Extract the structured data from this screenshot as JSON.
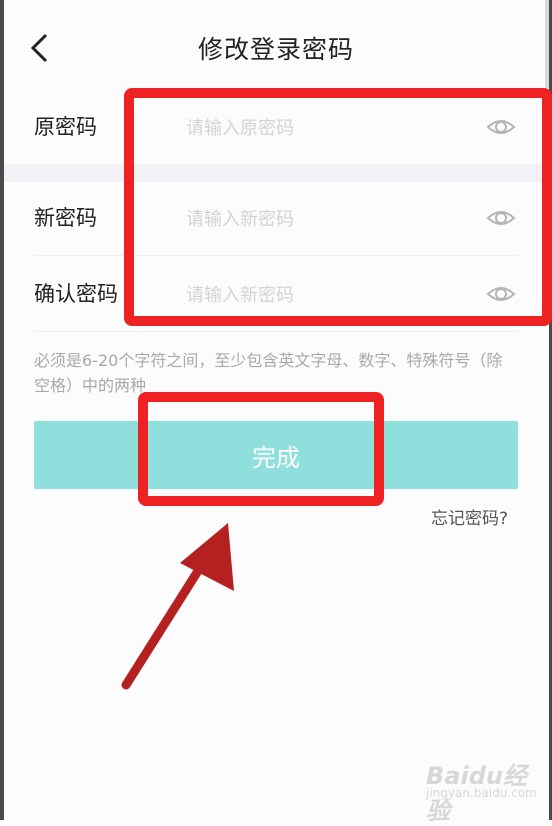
{
  "header": {
    "title": "修改登录密码",
    "back_icon": "chevron-left-icon"
  },
  "form": {
    "fields": [
      {
        "label": "原密码",
        "placeholder": "请输入原密码",
        "icon": "eye-icon"
      },
      {
        "label": "新密码",
        "placeholder": "请输入新密码",
        "icon": "eye-icon"
      },
      {
        "label": "确认密码",
        "placeholder": "请输入新密码",
        "icon": "eye-icon"
      }
    ],
    "hint": "必须是6-20个字符之间，至少包含英文字母、数字、特殊符号（除空格）中的两种",
    "submit_label": "完成",
    "forgot_label": "忘记密码?"
  },
  "annotation": {
    "color": "#ee2222",
    "arrow_color": "#b52020"
  },
  "theme": {
    "button_bg": "#8fe0dc",
    "band_bg": "#f2f1f5"
  },
  "watermark": {
    "main": "Baidu经验",
    "sub": "jingyan.baidu.com"
  }
}
